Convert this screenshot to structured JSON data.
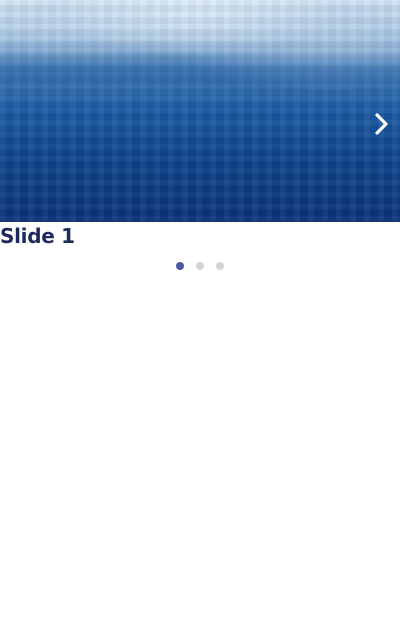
{
  "carousel": {
    "current_slide": 1,
    "slides": [
      {
        "caption": "Slide 1"
      },
      {
        "caption": ""
      },
      {
        "caption": ""
      }
    ],
    "next_icon": "chevron-right-icon",
    "colors": {
      "caption": "#1f2a5c",
      "dot_active": "#4a59a0",
      "dot_inactive": "#d3d3d3"
    }
  }
}
